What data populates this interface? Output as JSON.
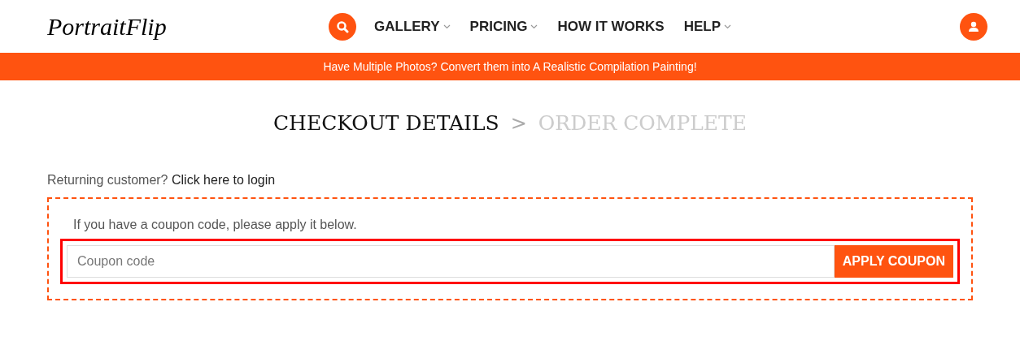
{
  "header": {
    "logo": "PortraitFlip",
    "nav": [
      {
        "label": "GALLERY",
        "dropdown": true
      },
      {
        "label": "PRICING",
        "dropdown": true
      },
      {
        "label": "HOW IT WORKS",
        "dropdown": false
      },
      {
        "label": "HELP",
        "dropdown": true
      }
    ]
  },
  "banner": "Have Multiple Photos? Convert them into A Realistic Compilation Painting!",
  "steps": [
    {
      "label": "CHECKOUT DETAILS",
      "selected": true
    },
    {
      "label": "ORDER COMPLETE",
      "selected": false
    }
  ],
  "step_separator": ">",
  "returning": {
    "text": "Returning customer?",
    "link": "Click here to login"
  },
  "coupon": {
    "hint": "If you have a coupon code, please apply it below.",
    "placeholder": "Coupon code",
    "button": "APPLY COUPON",
    "highlighted": true
  }
}
